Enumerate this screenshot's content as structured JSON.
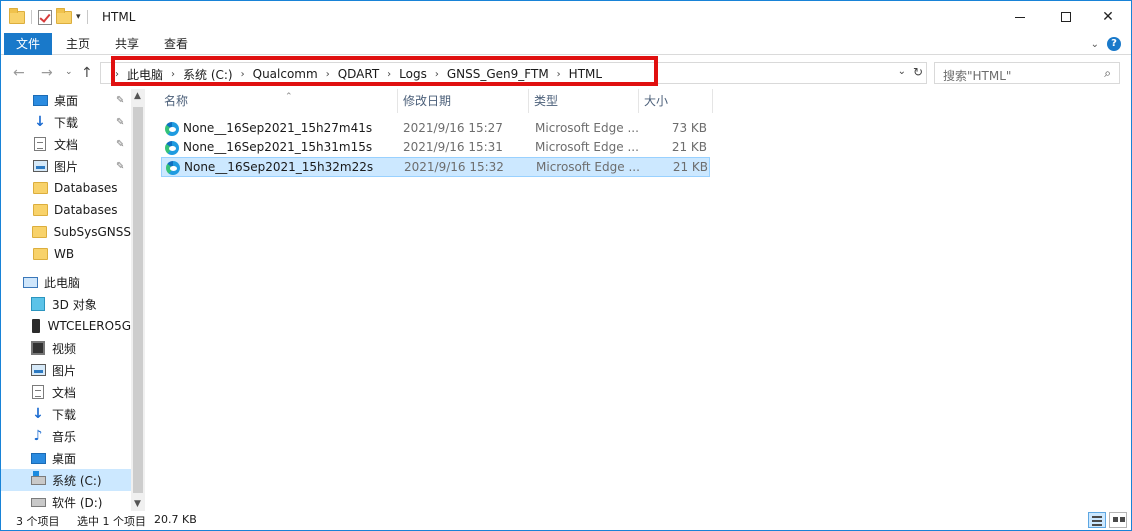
{
  "window": {
    "title": "HTML"
  },
  "ribbon": {
    "tabs": [
      "文件",
      "主页",
      "共享",
      "查看"
    ]
  },
  "address": {
    "breadcrumbs": [
      "此电脑",
      "系统 (C:)",
      "Qualcomm",
      "QDART",
      "Logs",
      "GNSS_Gen9_FTM",
      "HTML"
    ]
  },
  "search": {
    "placeholder": "搜索\"HTML\""
  },
  "sidebar": {
    "items": [
      {
        "label": "桌面",
        "icon": "desktop-icon",
        "pinned": true
      },
      {
        "label": "下载",
        "icon": "download-icon",
        "pinned": true
      },
      {
        "label": "文档",
        "icon": "document-icon",
        "pinned": true
      },
      {
        "label": "图片",
        "icon": "pictures-icon",
        "pinned": true
      },
      {
        "label": "Databases",
        "icon": "folder-icon",
        "pinned": false
      },
      {
        "label": "Databases",
        "icon": "folder-icon",
        "pinned": false
      },
      {
        "label": "SubSysGNSS",
        "icon": "folder-icon",
        "pinned": false
      },
      {
        "label": "WB",
        "icon": "folder-icon",
        "pinned": false
      },
      {
        "label": "此电脑",
        "icon": "computer-icon",
        "pinned": false
      },
      {
        "label": "3D 对象",
        "icon": "3d-objects-icon",
        "pinned": false
      },
      {
        "label": "WTCELERO5G",
        "icon": "phone-icon",
        "pinned": false
      },
      {
        "label": "视频",
        "icon": "video-icon",
        "pinned": false
      },
      {
        "label": "图片",
        "icon": "pictures-icon",
        "pinned": false
      },
      {
        "label": "文档",
        "icon": "document-icon",
        "pinned": false
      },
      {
        "label": "下载",
        "icon": "download-icon",
        "pinned": false
      },
      {
        "label": "音乐",
        "icon": "music-icon",
        "pinned": false
      },
      {
        "label": "桌面",
        "icon": "desktop-icon",
        "pinned": false
      },
      {
        "label": "系统 (C:)",
        "icon": "system-drive-icon",
        "pinned": false,
        "selected": true
      },
      {
        "label": "软件 (D:)",
        "icon": "drive-icon",
        "pinned": false
      }
    ]
  },
  "columns": {
    "name": "名称",
    "date": "修改日期",
    "type": "类型",
    "size": "大小"
  },
  "files": [
    {
      "name": "None__16Sep2021_15h27m41s",
      "date": "2021/9/16 15:27",
      "type": "Microsoft Edge ...",
      "size": "73 KB",
      "selected": false
    },
    {
      "name": "None__16Sep2021_15h31m15s",
      "date": "2021/9/16 15:31",
      "type": "Microsoft Edge ...",
      "size": "21 KB",
      "selected": false
    },
    {
      "name": "None__16Sep2021_15h32m22s",
      "date": "2021/9/16 15:32",
      "type": "Microsoft Edge ...",
      "size": "21 KB",
      "selected": true
    }
  ],
  "status": {
    "count": "3 个项目",
    "selection": "选中 1 个项目",
    "size": "20.7 KB"
  },
  "colors": {
    "accent": "#1979ca",
    "selection": "#cce8ff",
    "highlight": "#e01010"
  }
}
